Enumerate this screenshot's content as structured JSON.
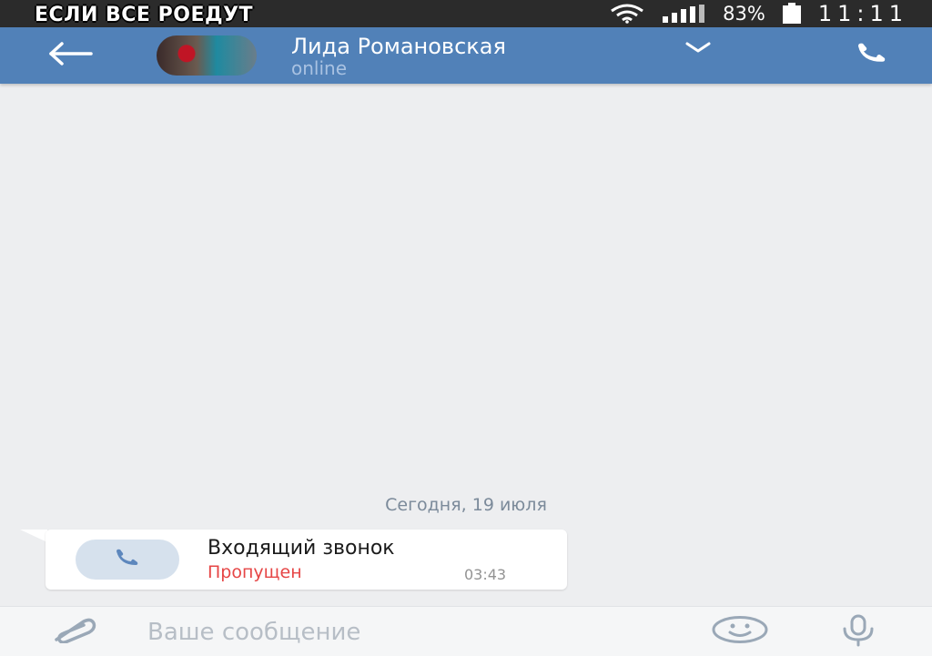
{
  "status_bar": {
    "caption": "ЕСЛИ ВСЕ РОЕДУТ",
    "battery_percent": "83%",
    "time": "11:11",
    "icons": [
      "wifi-icon",
      "signal-icon",
      "battery-icon"
    ]
  },
  "header": {
    "contact_name": "Лида Романовская",
    "contact_status": "online",
    "icons": [
      "back-arrow-icon",
      "avatar",
      "chevron-down-icon",
      "phone-icon"
    ]
  },
  "conversation": {
    "date_separator": "Сегодня, 19 июля",
    "messages": [
      {
        "type": "call",
        "title": "Входящий звонок",
        "status": "Пропущен",
        "time": "03:43",
        "icon": "phone-icon"
      }
    ]
  },
  "composer": {
    "placeholder": "Ваше сообщение",
    "icons": [
      "paperclip-icon",
      "smiley-icon",
      "microphone-icon"
    ]
  },
  "colors": {
    "header_bg": "#5181b8",
    "chat_bg": "#edeef0",
    "missed_red": "#e64646",
    "status_bar_bg": "#2b2b2b"
  }
}
